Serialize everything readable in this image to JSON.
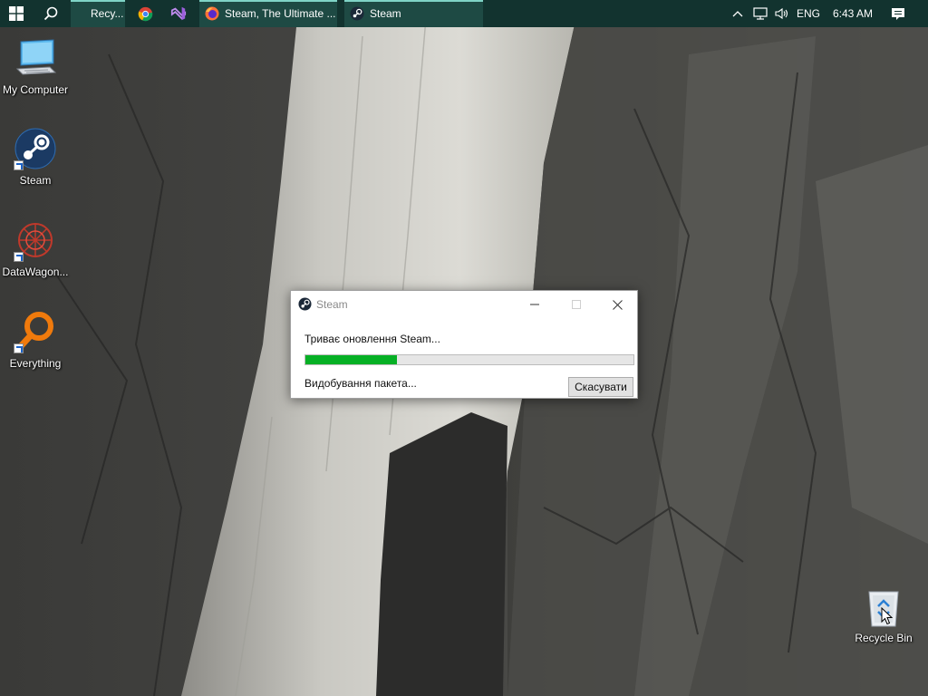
{
  "taskbar": {
    "items": [
      {
        "label": "Recy..."
      },
      {
        "label": "Steam, The Ultimate ..."
      },
      {
        "label": "Steam"
      }
    ],
    "tray": {
      "language": "ENG",
      "time": "6:43 AM"
    }
  },
  "desktop": {
    "icons": [
      {
        "label": "My Computer"
      },
      {
        "label": "Steam"
      },
      {
        "label": "DataWagon..."
      },
      {
        "label": "Everything"
      },
      {
        "label": "Recycle Bin"
      }
    ]
  },
  "dialog": {
    "title": "Steam",
    "status": "Триває оновлення Steam...",
    "progress_percent": 28,
    "substatus": "Видобування пакета...",
    "cancel_label": "Скасувати"
  },
  "colors": {
    "taskbar_bg": "#12332f",
    "progress_fill": "#06b025"
  }
}
